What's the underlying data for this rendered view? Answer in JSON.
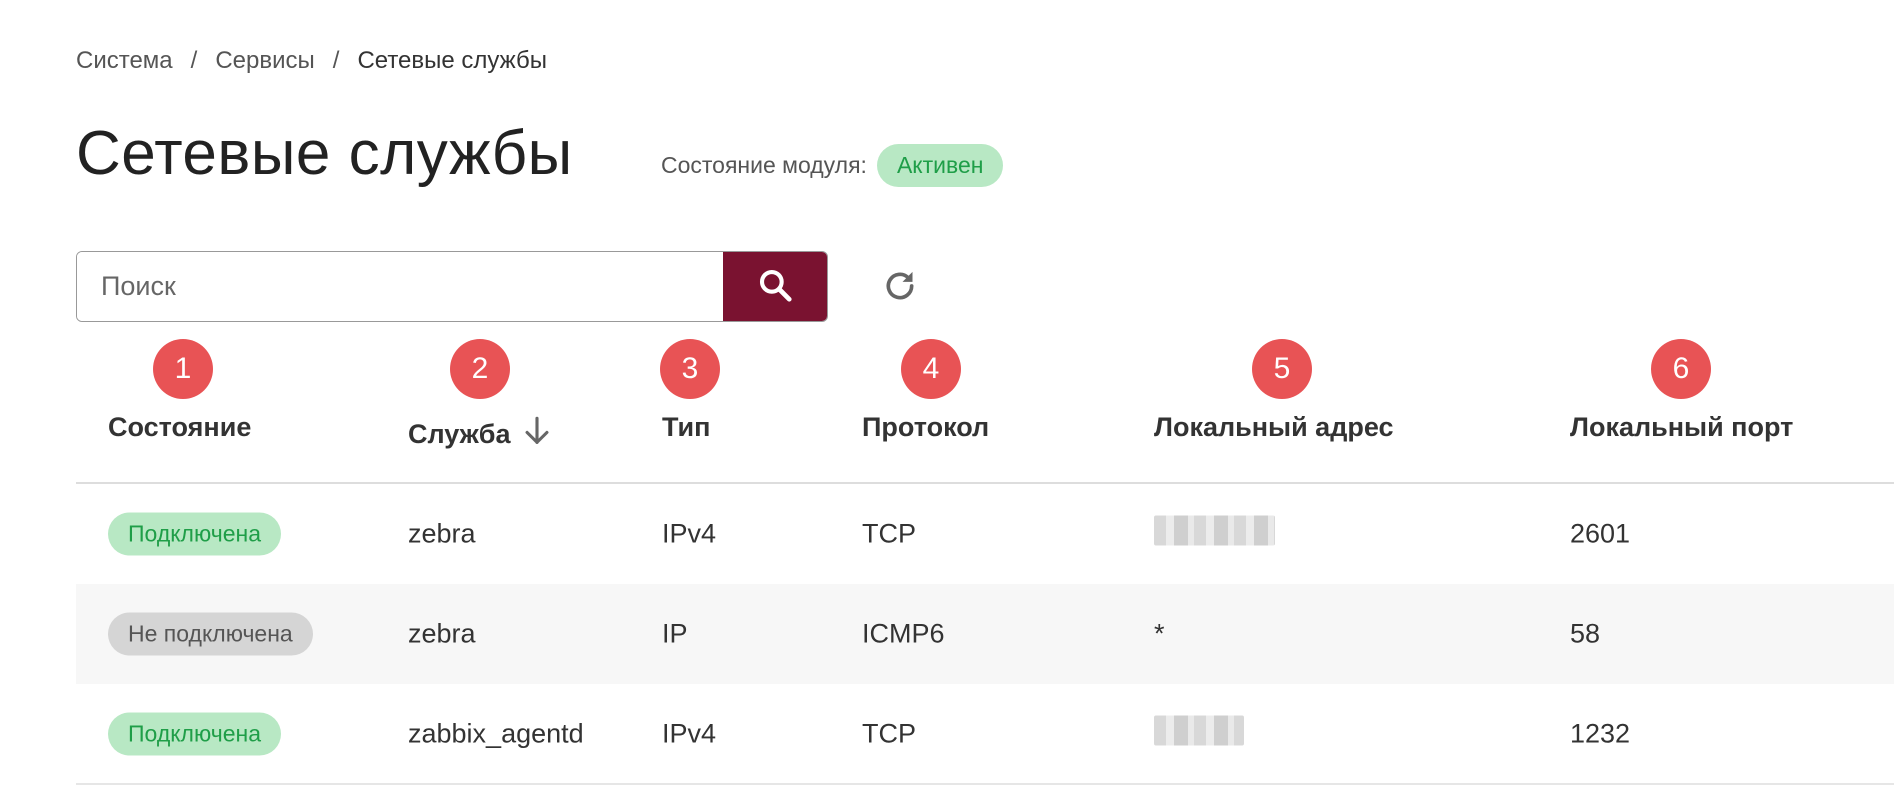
{
  "breadcrumb": {
    "items": [
      "Система",
      "Сервисы",
      "Сетевые службы"
    ],
    "separator": "/"
  },
  "page": {
    "title": "Сетевые службы",
    "module_state_label": "Состояние модуля:",
    "module_state_value": "Активен"
  },
  "search": {
    "placeholder": "Поиск",
    "value": ""
  },
  "icons": {
    "search": "search-icon",
    "refresh": "refresh-icon",
    "sort": "arrow-down-icon"
  },
  "colors": {
    "accent": "#7a1230",
    "annotation": "#e85355",
    "status_on_bg": "#b8e8c4",
    "status_on_text": "#1f9e48",
    "status_off_bg": "#d5d5d5"
  },
  "annotations": [
    "1",
    "2",
    "3",
    "4",
    "5",
    "6"
  ],
  "table": {
    "columns": [
      "Состояние",
      "Служба",
      "Тип",
      "Протокол",
      "Локальный адрес",
      "Локальный порт"
    ],
    "sorted_column": "Служба",
    "rows": [
      {
        "status": "Подключена",
        "status_kind": "on",
        "service": "zebra",
        "type": "IPv4",
        "protocol": "TCP",
        "address": "",
        "address_hidden": true,
        "port": "2601"
      },
      {
        "status": "Не подключена",
        "status_kind": "off",
        "service": "zebra",
        "type": "IP",
        "protocol": "ICMP6",
        "address": "*",
        "address_hidden": false,
        "port": "58"
      },
      {
        "status": "Подключена",
        "status_kind": "on",
        "service": "zabbix_agentd",
        "type": "IPv4",
        "protocol": "TCP",
        "address": "",
        "address_hidden": true,
        "port": "1232"
      }
    ]
  }
}
